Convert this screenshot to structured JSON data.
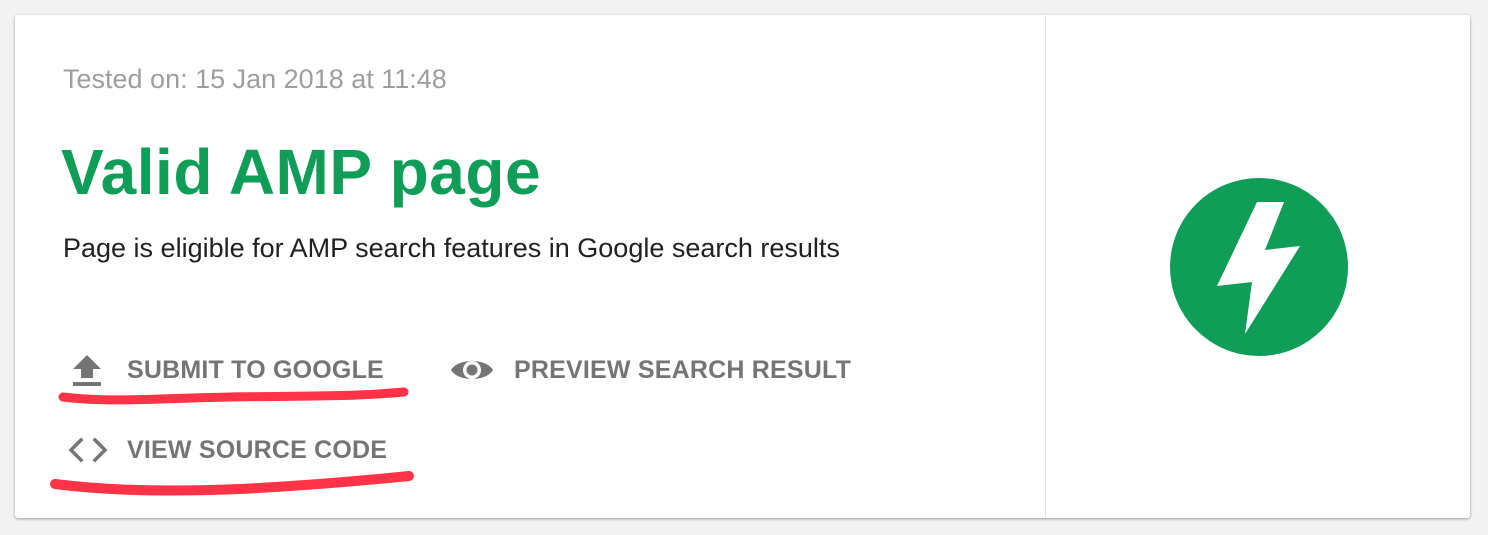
{
  "result": {
    "tested_on": "Tested on: 15 Jan 2018 at 11:48",
    "title": "Valid AMP page",
    "description": "Page is eligible for AMP search features in Google search results"
  },
  "actions": {
    "submit_label": "SUBMIT TO GOOGLE",
    "preview_label": "PREVIEW SEARCH RESULT",
    "source_label": "VIEW SOURCE CODE"
  },
  "icons": {
    "submit": "upload-icon",
    "preview": "eye-icon",
    "source": "code-brackets-icon",
    "status": "amp-lightning-logo"
  },
  "colors": {
    "valid_green": "#0f9d58",
    "muted_text": "#9e9e9e",
    "action_text": "#757575",
    "annotation_red": "#ff3347"
  }
}
